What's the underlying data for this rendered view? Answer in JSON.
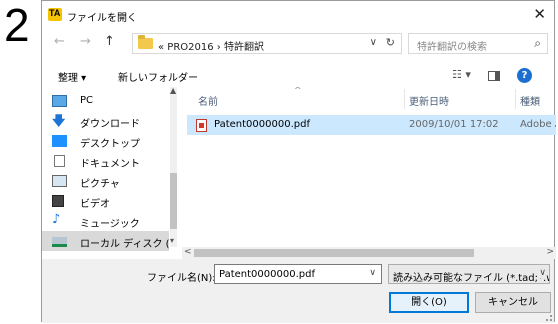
{
  "step_number": "2",
  "window": {
    "title": "ファイルを開く",
    "app_icon_text": "TA",
    "close_glyph": "✕"
  },
  "nav": {
    "back": "←",
    "forward": "→",
    "up": "↑",
    "address_path": "« PRO2016 › 特許翻訳",
    "address_dropdown": "∨",
    "refresh": "↻",
    "search_placeholder": "特許翻訳の検索",
    "search_icon": "⌕"
  },
  "toolbar": {
    "organize": "整理 ▾",
    "new_folder": "新しいフォルダー",
    "view_icon": "☷ ▾",
    "help": "?"
  },
  "sidebar": {
    "items": [
      {
        "label": "PC",
        "icon": "pc-icon"
      },
      {
        "label": "ダウンロード",
        "icon": "download-icon"
      },
      {
        "label": "デスクトップ",
        "icon": "desktop-icon"
      },
      {
        "label": "ドキュメント",
        "icon": "document-icon"
      },
      {
        "label": "ピクチャ",
        "icon": "picture-icon"
      },
      {
        "label": "ビデオ",
        "icon": "video-icon"
      },
      {
        "label": "ミュージック",
        "icon": "music-icon"
      },
      {
        "label": "ローカル ディスク (C",
        "icon": "local-disk-icon"
      }
    ],
    "scroll_up": "▲",
    "scroll_down": "▾"
  },
  "file_list": {
    "columns": [
      "名前",
      "更新日時",
      "種類"
    ],
    "sort_indicator": "^",
    "rows": [
      {
        "name": "Patent0000000.pdf",
        "date": "2009/10/01 17:02",
        "type": "Adobe A"
      }
    ],
    "hscroll_left": "<",
    "hscroll_right": ">"
  },
  "bottom": {
    "filename_label": "ファイル名(N):",
    "filename_value": "Patent0000000.pdf",
    "filename_dropdown": "∨",
    "filetype_value": "読み込み可能なファイル (*.tad;*.w",
    "filetype_dropdown": "∨",
    "open_button": "開く(O)",
    "cancel_button": "キャンセル"
  },
  "colors": {
    "selection": "#cce8ff",
    "accent": "#0078d7",
    "help": "#1c6fd1"
  }
}
